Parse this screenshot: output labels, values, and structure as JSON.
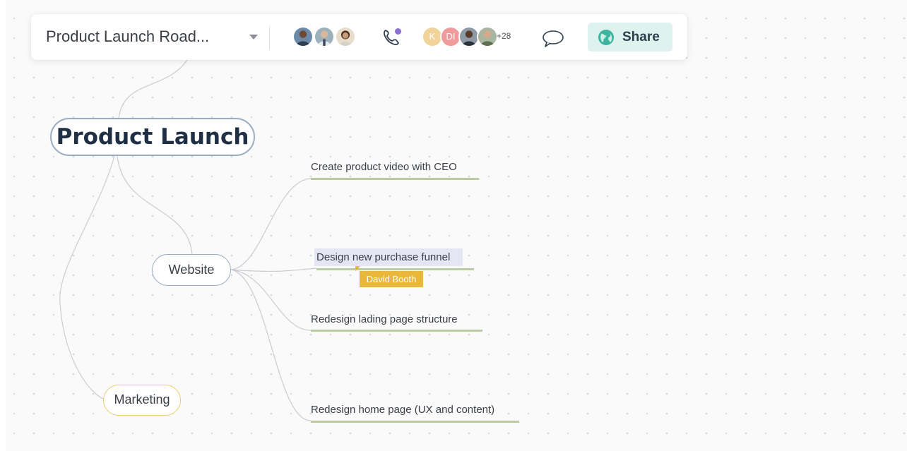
{
  "header": {
    "title": "Product Launch Road...",
    "more_collaborators": "+28",
    "share_label": "Share",
    "call_icon": "phone-icon",
    "comment_icon": "comment-icon",
    "share_icon": "globe-icon"
  },
  "collaborators": {
    "letter_avatars": [
      {
        "initial": "K",
        "color": "#f1d49a"
      },
      {
        "initial": "DI",
        "color": "#ef9b9b"
      }
    ]
  },
  "mindmap": {
    "root": "Product Launch",
    "branches": {
      "website": "Website",
      "marketing": "Marketing"
    },
    "tasks": [
      "Create product video with CEO",
      "Design new purchase funnel",
      "Redesign lading page structure",
      "Redesign home page (UX and content)"
    ],
    "cursor_user": "David Booth"
  },
  "colors": {
    "root_border": "#9aacc4",
    "marketing_border": "#f0cc6f",
    "task_underline": "#b9cca3",
    "cursor": "#e9b73c",
    "share_bg": "#dff2ee"
  }
}
